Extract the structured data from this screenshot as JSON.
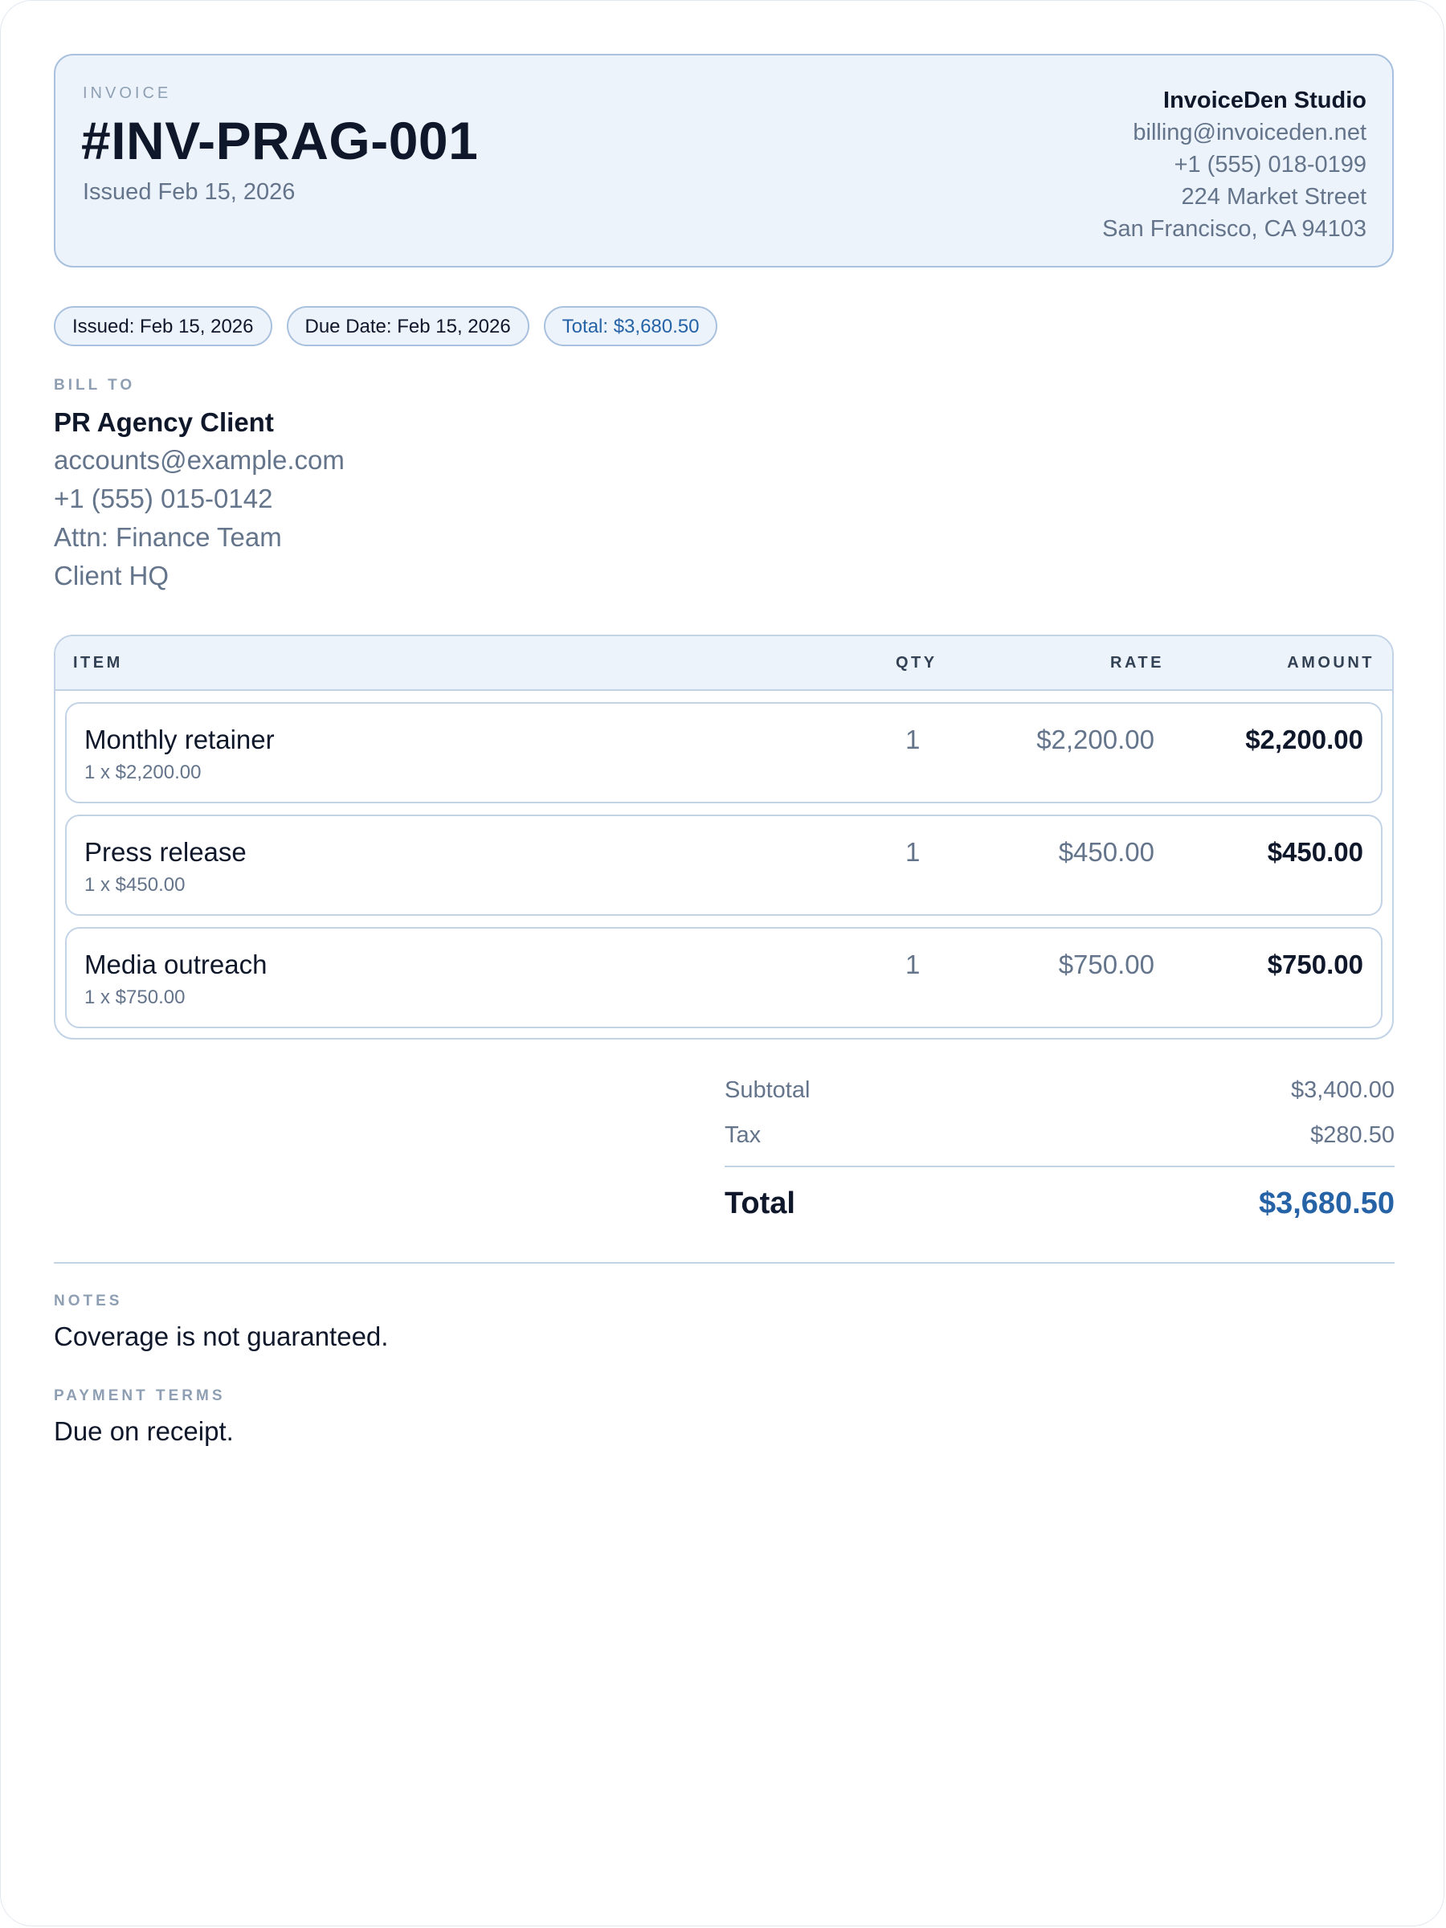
{
  "header": {
    "label": "INVOICE",
    "invoice_number": "#INV-PRAG-001",
    "issued": "Issued Feb 15, 2026"
  },
  "company": {
    "name": "InvoiceDen Studio",
    "email": "billing@invoiceden.net",
    "phone": "+1 (555) 018-0199",
    "street": "224 Market Street",
    "city": "San Francisco, CA 94103"
  },
  "pills": {
    "issued": "Issued: Feb 15, 2026",
    "due": "Due Date: Feb 15, 2026",
    "total": "Total: $3,680.50"
  },
  "bill_to": {
    "label": "BILL TO",
    "name": "PR Agency Client",
    "email": "accounts@example.com",
    "phone": "+1 (555) 015-0142",
    "attn": "Attn: Finance Team",
    "location": "Client HQ"
  },
  "table": {
    "headers": {
      "item": "ITEM",
      "qty": "QTY",
      "rate": "RATE",
      "amount": "AMOUNT"
    },
    "rows": [
      {
        "title": "Monthly retainer",
        "sub": "1 x $2,200.00",
        "qty": "1",
        "rate": "$2,200.00",
        "amount": "$2,200.00"
      },
      {
        "title": "Press release",
        "sub": "1 x $450.00",
        "qty": "1",
        "rate": "$450.00",
        "amount": "$450.00"
      },
      {
        "title": "Media outreach",
        "sub": "1 x $750.00",
        "qty": "1",
        "rate": "$750.00",
        "amount": "$750.00"
      }
    ]
  },
  "totals": {
    "subtotal_label": "Subtotal",
    "subtotal_value": "$3,400.00",
    "tax_label": "Tax",
    "tax_value": "$280.50",
    "total_label": "Total",
    "total_value": "$3,680.50"
  },
  "notes": {
    "label": "NOTES",
    "text": "Coverage is not guaranteed."
  },
  "terms": {
    "label": "PAYMENT TERMS",
    "text": "Due on receipt."
  },
  "colors": {
    "accent": "#2563a6",
    "panel_bg": "#edf3fb",
    "border": "#a9c1de",
    "text_primary": "#0f172a",
    "text_muted": "#64748b"
  }
}
